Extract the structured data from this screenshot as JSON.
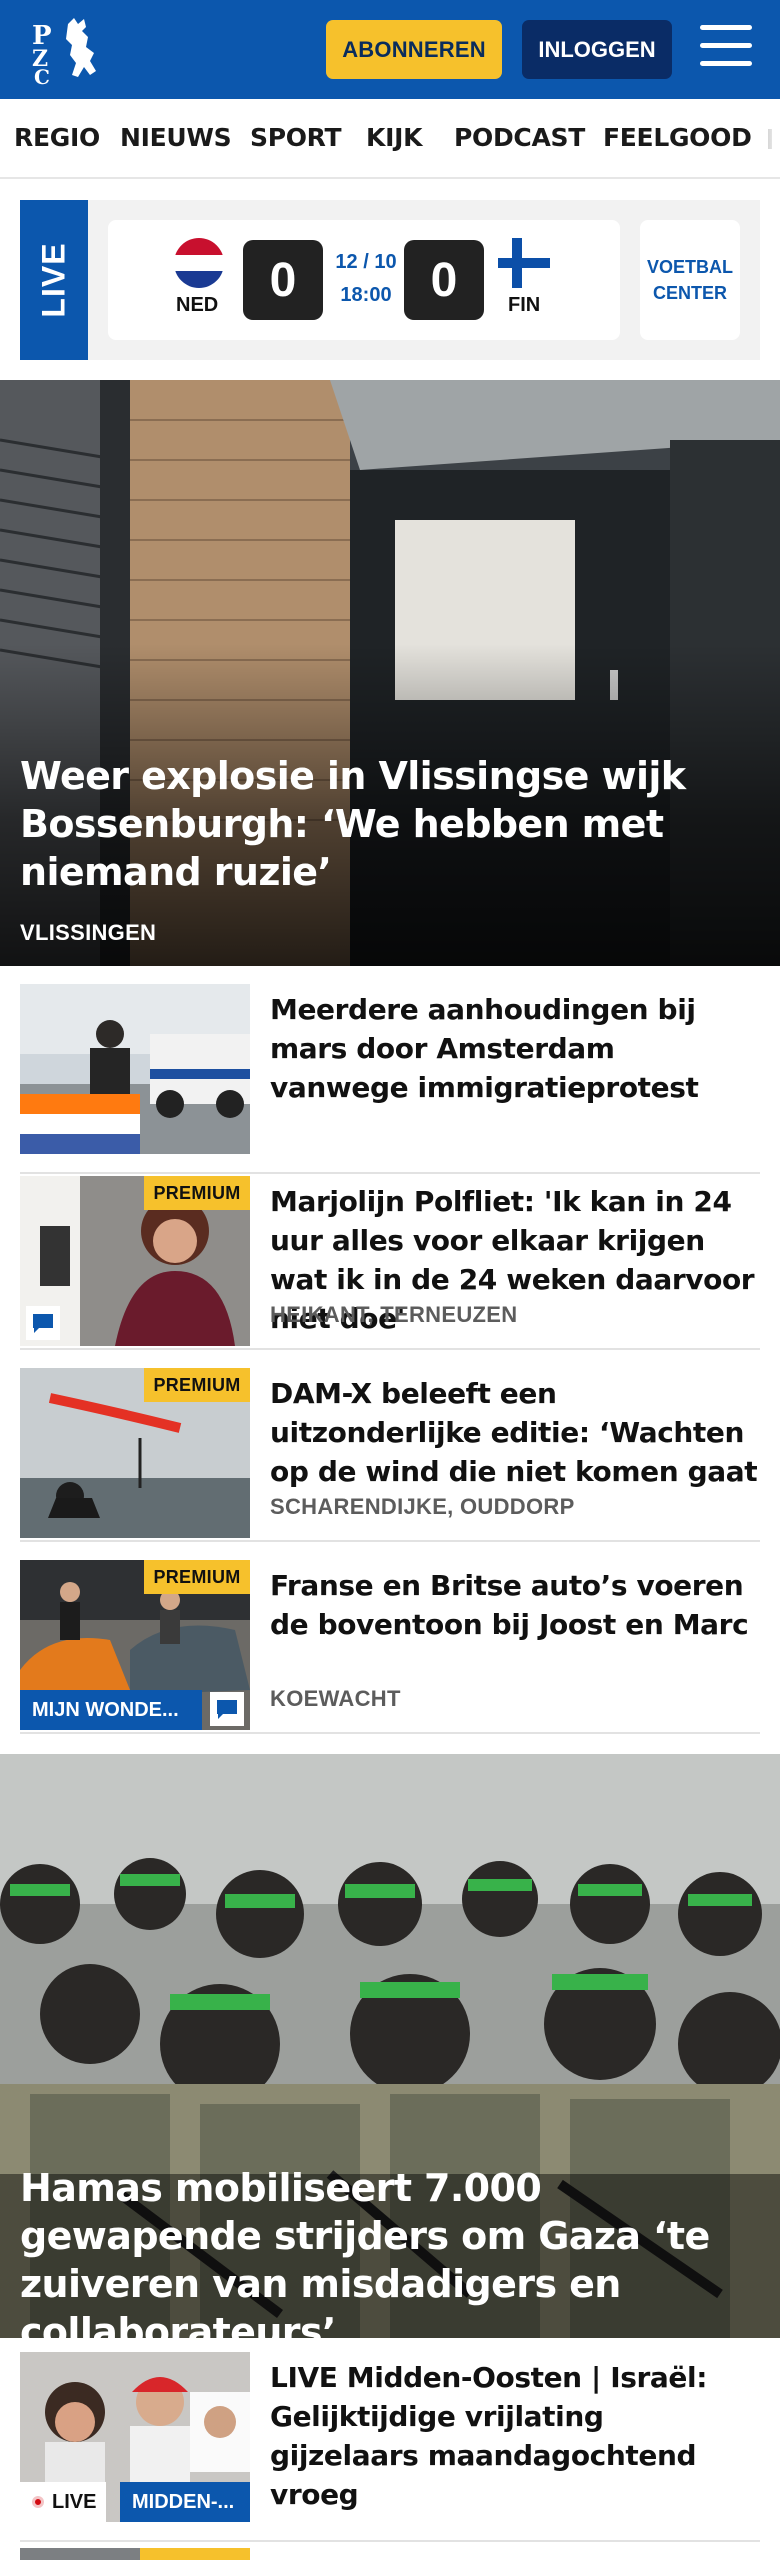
{
  "header": {
    "logo_text": "PZC",
    "subscribe_label": "ABONNEREN",
    "login_label": "INLOGGEN",
    "colors": {
      "brand_blue": "#0c57ad",
      "accent_yellow": "#f6c12c"
    }
  },
  "nav": {
    "items": [
      {
        "label": "REGIO"
      },
      {
        "label": "NIEUWS"
      },
      {
        "label": "SPORT"
      },
      {
        "label": "KIJK"
      },
      {
        "label": "PODCAST"
      },
      {
        "label": "FEELGOOD"
      }
    ]
  },
  "live": {
    "tag": "LIVE",
    "home_team": "NED",
    "away_team": "FIN",
    "home_score": "0",
    "away_score": "0",
    "date": "12 / 10",
    "time": "18:00",
    "center_label_1": "VOETBAL",
    "center_label_2": "CENTER"
  },
  "hero": {
    "title": "Weer explosie in Vlissingse wijk Bossenburgh: ‘We hebben met niemand ruzie’",
    "category": "VLISSINGEN"
  },
  "articles": [
    {
      "title": "Meerdere aanhoudingen bij mars door Amsterdam vanwege immigratieprotest",
      "meta": ""
    },
    {
      "title": "Marjolijn Polfliet: 'Ik kan in 24 uur alles voor elkaar krijgen wat ik in de 24 weken daarvoor niet doe'",
      "meta": "HEIKANT, TERNEUZEN",
      "badge": "PREMIUM"
    },
    {
      "title": "DAM-X beleeft een uitzonderlijke editie: ‘Wachten op de wind die niet komen gaat",
      "meta": "SCHARENDIJKE, OUDDORP",
      "badge": "PREMIUM"
    },
    {
      "title": "Franse en Britse auto’s voeren de boventoon bij Joost en Marc",
      "meta": "KOEWACHT",
      "badge": "PREMIUM",
      "tag": "MIJN WONDE..."
    }
  ],
  "hero2": {
    "title": "Hamas mobiliseert 7.000 gewapende strijders om Gaza ‘te zuiveren van misdadigers en collaborateurs’"
  },
  "live_article": {
    "title": "LIVE Midden-Oosten | Israël: Gelijktijdige vrijlating gijzelaars maandagochtend vroeg",
    "live_tag": "LIVE",
    "section_tag": "MIDDEN-..."
  }
}
